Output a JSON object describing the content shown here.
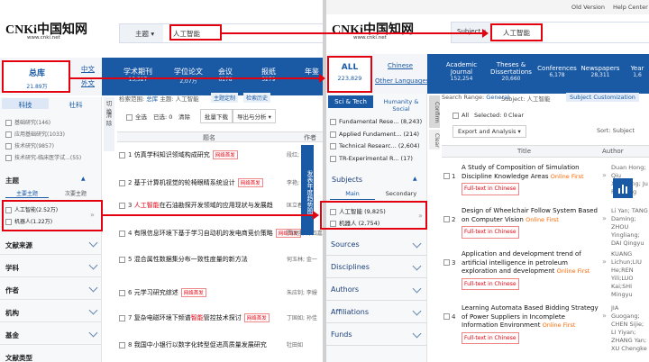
{
  "left": {
    "logo": {
      "main": "CNKi中国知网",
      "url": "www.cnki.net"
    },
    "search": {
      "field": "主题",
      "query": "人工智能"
    },
    "lang": {
      "zh": "中文",
      "en": "外文"
    },
    "total": {
      "label": "总库",
      "count": "21.89万"
    },
    "db_tabs": [
      {
        "label": "学术期刊",
        "count": "15,527"
      },
      {
        "label": "学位论文",
        "count": "2,07万"
      },
      {
        "label": "会议",
        "count": "6178"
      },
      {
        "label": "报纸",
        "count": "5279"
      },
      {
        "label": "年鉴",
        "count": ""
      }
    ],
    "side_tabs": [
      "科技",
      "社科"
    ],
    "filters": [
      {
        "label": "基础研究",
        "count": "(146)"
      },
      {
        "label": "应用基础研究",
        "count": "(1033)"
      },
      {
        "label": "技术研究",
        "count": "(9857)"
      },
      {
        "label": "技术研究-临床医学试...",
        "count": "(55)"
      }
    ],
    "topic": {
      "title": "主题",
      "tabs": [
        "主要主题",
        "次要主题"
      ],
      "items": [
        {
          "label": "人工智能",
          "count": "(2.52万)"
        },
        {
          "label": "机器人",
          "count": "(1.22万)"
        }
      ]
    },
    "sections": [
      "文献来源",
      "学科",
      "作者",
      "机构",
      "基金",
      "文献类型"
    ],
    "toolbar": {
      "scope_label": "检索范围:",
      "scope_value": "总库",
      "subject_label": "主题: 人工智能",
      "custom": "主题定制",
      "history": "检索历史"
    },
    "actions": {
      "select_all": "全选",
      "selected": "已选:",
      "selected_count": "0",
      "clear": "清除",
      "bulk": "批量下载",
      "export": "导出与分析"
    },
    "side_buttons": {
      "switch": "切换",
      "clear": "清除"
    },
    "cols": {
      "title": "题名",
      "author": "作者"
    },
    "results": [
      {
        "n": "1",
        "title": "仿真学科知识领域构成研究",
        "tag": "网络首发",
        "author": "段红;"
      },
      {
        "n": "2",
        "title": "基于计算机视觉的轮椅眼睛系统设计",
        "tag": "网络首发",
        "author": "李艳; 汤琪"
      },
      {
        "n": "3",
        "title_pre": "",
        "title_hl": "人工智能",
        "title_post": "在石油勘探开发领域的应用现状与发展趋",
        "tag": "",
        "author": "匡立春"
      },
      {
        "n": "4",
        "title": "有限信息环境下基于学习自动机的发电商竞价策略",
        "tag": "网络首发",
        "author": "贾国强; 陈四嘉; 严"
      },
      {
        "n": "5",
        "title": "混合属性数据集分布一致性度量的新方法",
        "tag": "",
        "author": "何玉林; 金一"
      },
      {
        "n": "6",
        "title": "元学习研究综述",
        "tag": "网络首发",
        "author": "朱应钊; 李嫚"
      },
      {
        "n": "7",
        "title_pre": "复杂电磁环境下频谱",
        "title_hl": "智能",
        "title_post": "管控技术探讨",
        "tag": "网络首发",
        "author": "丁国如; 孙佳"
      },
      {
        "n": "8",
        "title": "我国中小银行以数字化转型促进高质量发展研究",
        "tag": "",
        "author": "牡田如"
      }
    ],
    "float_btn": "发表年度趋势图"
  },
  "right": {
    "top_links": [
      "Old Version",
      "Help Center"
    ],
    "logo": {
      "main": "CNKi中国知网",
      "url": "www.cnki.net"
    },
    "search": {
      "field": "Subject",
      "query": "人工智能"
    },
    "all": {
      "label": "ALL",
      "count": "223,829"
    },
    "lang": {
      "zh": "Chinese",
      "en": "Other Languages"
    },
    "db_tabs": [
      {
        "label": "Academic Journal",
        "count": "152,254"
      },
      {
        "label": "Theses & Dissertations",
        "count": "20,660"
      },
      {
        "label": "Conferences",
        "count": "6,178"
      },
      {
        "label": "Newspapers",
        "count": "28,311"
      },
      {
        "label": "Year",
        "count": "1,6"
      }
    ],
    "side_tabs": [
      "Sci & Tech",
      "Humanity & Social"
    ],
    "filters": [
      {
        "label": "Fundamental Rese...",
        "count": "(8,243)"
      },
      {
        "label": "Applied Fundament...",
        "count": "(214)"
      },
      {
        "label": "Technical Researc...",
        "count": "(2,604)"
      },
      {
        "label": "TR-Experimental R...",
        "count": "(17)"
      }
    ],
    "subjects": {
      "title": "Subjects",
      "tabs": [
        "Main",
        "Secondary"
      ],
      "items": [
        {
          "label": "人工智能",
          "count": "(9,825)"
        },
        {
          "label": "机器人",
          "count": "(2,754)"
        }
      ]
    },
    "sections": [
      "Sources",
      "Disciplines",
      "Authors",
      "Affiliations",
      "Funds"
    ],
    "toolbar": {
      "range_label": "Search Range:",
      "range_value": "General",
      "subject_label": "Subject: 人工智能",
      "custom": "Subject Customization"
    },
    "side_buttons": {
      "confirm": "Confirm",
      "clear": "Clear"
    },
    "actions": {
      "all": "All",
      "selected": "Selected:",
      "selected_count": "0",
      "clear": "Clear",
      "export": "Export and Analysis",
      "sort_label": "Sort:",
      "sort_value": "Subject"
    },
    "cols": {
      "title": "Title",
      "author": "Author"
    },
    "results": [
      {
        "n": "1",
        "title": "A Study of Composition of Simulation Discipline Knowledge Areas",
        "online": "Online First",
        "tag": "Full-text in Chinese",
        "author": "Duan Hong; Qiu Xiaogang; Ju Rusheng"
      },
      {
        "n": "2",
        "title": "Design of Wheelchair Follow System Based on Computer Vision",
        "online": "Online First",
        "tag": "Full-text in Chinese",
        "author": "Li Yan; TANG Daming; ZHOU Yingliang; DAI Qingyu"
      },
      {
        "n": "3",
        "title": "Application and development trend of artificial intelligence in petroleum exploration and development",
        "online": "Online First",
        "tag": "Full-text in Chinese",
        "author": "KUANG Lichun;LIU He;REN Yili;LUO Kai;SHI Mingyu"
      },
      {
        "n": "4",
        "title": "Learning Automata Based Bidding Strategy of Power Suppliers in Incomplete Information Environment",
        "online": "Online First",
        "tag": "Full-text in Chinese",
        "author": "JIA Guogang; CHEN Sijie; LI Yiyan; ZHANG Yan; XU Chengke"
      }
    ]
  },
  "colors": {
    "blue": "#1a5aa5",
    "red": "#e3000f",
    "online": "#ff6600"
  }
}
